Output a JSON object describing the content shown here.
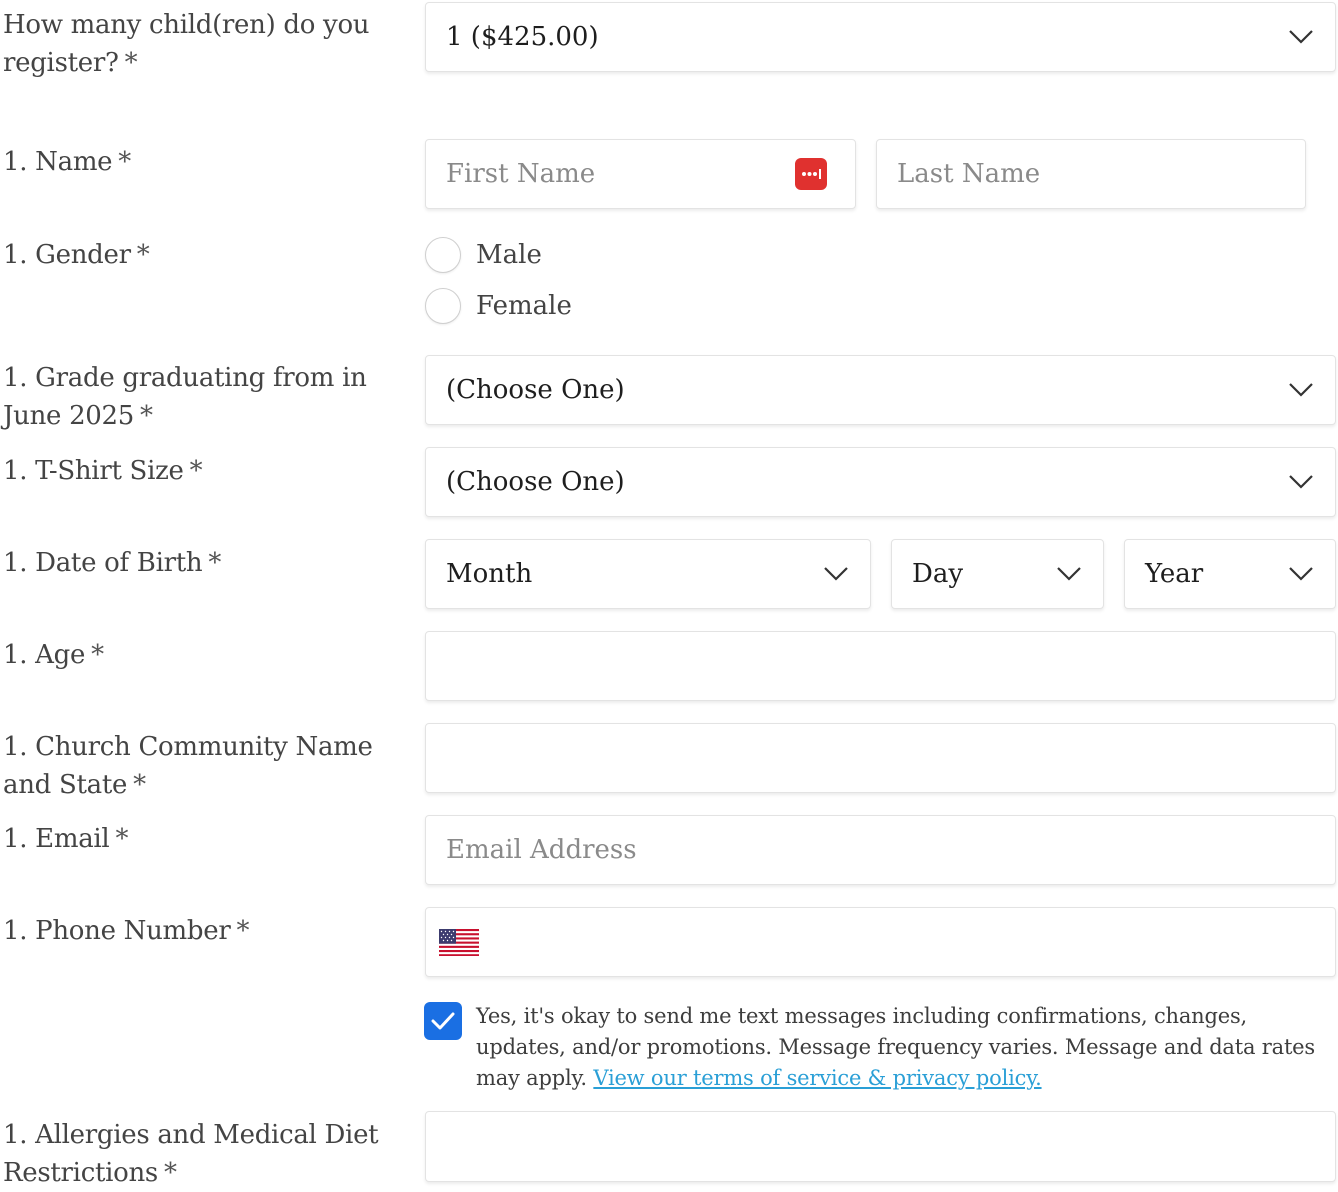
{
  "children_count": {
    "label_line1": "How many child(ren) do you",
    "label_line2": "register?",
    "selected": "1 ($425.00)"
  },
  "required_mark": "*",
  "name": {
    "label": "1. Name",
    "first_placeholder": "First Name",
    "last_placeholder": "Last Name"
  },
  "gender": {
    "label": "1. Gender",
    "options": [
      "Male",
      "Female"
    ]
  },
  "grade": {
    "label_line1": "1. Grade graduating from in",
    "label_line2": "June 2025",
    "selected": "(Choose One)"
  },
  "tshirt": {
    "label": "1. T-Shirt Size",
    "selected": "(Choose One)"
  },
  "dob": {
    "label": "1. Date of Birth",
    "month": "Month",
    "day": "Day",
    "year": "Year"
  },
  "age": {
    "label": "1. Age",
    "value": ""
  },
  "church": {
    "label_line1": "1. Church Community Name",
    "label_line2": "and State",
    "value": ""
  },
  "email": {
    "label": "1. Email",
    "placeholder": "Email Address"
  },
  "phone": {
    "label": "1. Phone Number",
    "country_flag_icon": "us-flag-icon",
    "value": ""
  },
  "sms_consent": {
    "checked": true,
    "text": "Yes, it's okay to send me text messages including confirmations, changes, updates, and/or promotions. Message frequency varies. Message and data rates may apply.",
    "link_text": "View our terms of service & privacy policy."
  },
  "allergies": {
    "label_line1": "1. Allergies and Medical Diet",
    "label_line2": "Restrictions",
    "value": ""
  },
  "colors": {
    "checkbox_blue": "#1a6fe3",
    "link_blue": "#2a9fd6",
    "password_icon_red": "#e0312f"
  }
}
